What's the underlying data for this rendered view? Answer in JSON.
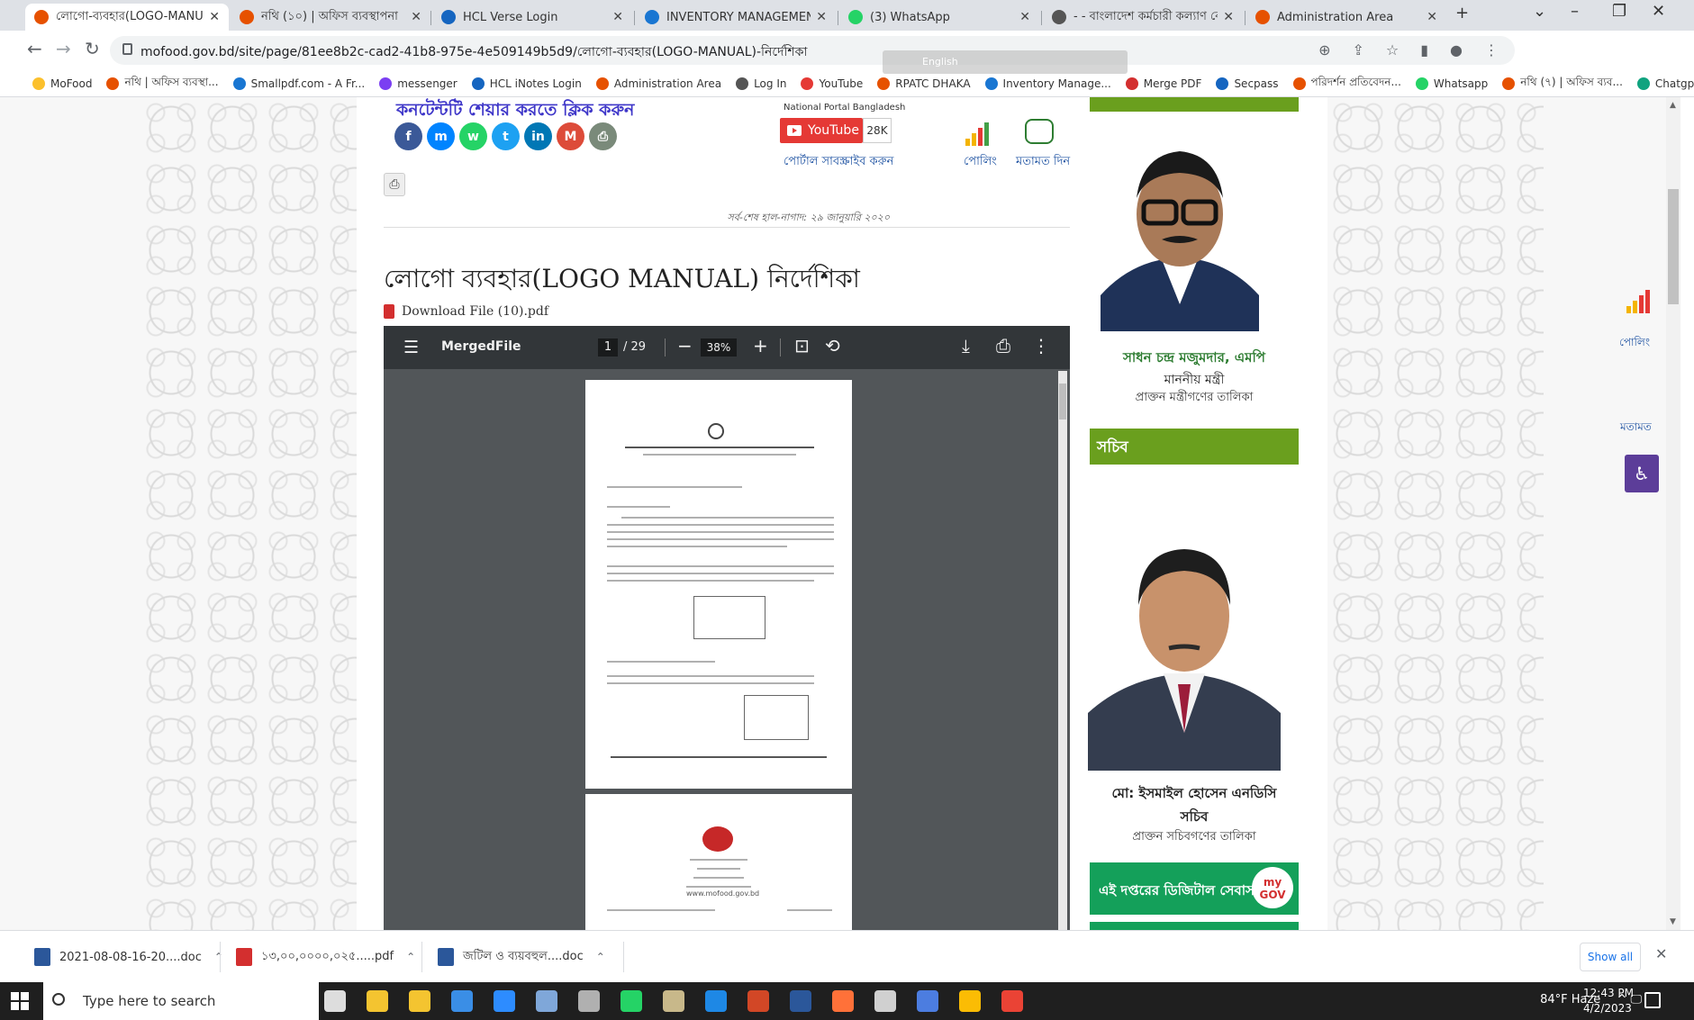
{
  "browser": {
    "tabs": [
      {
        "title": "লোগো-ব্যবহার(LOGO-MANUAL)",
        "color": "#e65100",
        "active": true
      },
      {
        "title": "নথি (১০) | অফিস ব্যবস্থাপনা",
        "color": "#e65100"
      },
      {
        "title": "HCL Verse Login",
        "color": "#1565c0"
      },
      {
        "title": "INVENTORY MANAGEMENT SYS",
        "color": "#1976d2"
      },
      {
        "title": "(3) WhatsApp",
        "color": "#25d366"
      },
      {
        "title": "- - বাংলাদেশ কর্মচারী কল্যাণ বো",
        "color": "#555555"
      },
      {
        "title": "Administration Area",
        "color": "#e65100"
      }
    ],
    "new_tab": "+",
    "window_controls": {
      "dropdown": "⌄",
      "minimize": "–",
      "restore": "❐",
      "close": "✕"
    },
    "nav": {
      "back": "←",
      "forward": "→",
      "reload": "↻"
    },
    "url": "mofood.gov.bd/site/page/81ee8b2c-cad2-41b8-975e-4e509149b5d9/লোগো-ব্যবহার(LOGO-MANUAL)-নির্দেশিকা",
    "omni_icons": {
      "zoom": "⊕",
      "share": "⇪",
      "star": "☆",
      "sidepanel": "▮",
      "profile": "●",
      "menu": "⋮"
    },
    "lang_strip": "English",
    "bookmarks": [
      {
        "label": "MoFood",
        "color": "#fbc02d"
      },
      {
        "label": "নথি | অফিস ব্যবস্থা...",
        "color": "#e65100"
      },
      {
        "label": "Smallpdf.com - A Fr...",
        "color": "#1976d2"
      },
      {
        "label": "messenger",
        "color": "#7b3ff2"
      },
      {
        "label": "HCL iNotes Login",
        "color": "#1565c0"
      },
      {
        "label": "Administration Area",
        "color": "#e65100"
      },
      {
        "label": "Log In",
        "color": "#555555"
      },
      {
        "label": "YouTube",
        "color": "#e53935"
      },
      {
        "label": "RPATC DHAKA",
        "color": "#e65100"
      },
      {
        "label": "Inventory Manage...",
        "color": "#1976d2"
      },
      {
        "label": "Merge PDF",
        "color": "#d32f2f"
      },
      {
        "label": "Secpass",
        "color": "#1565c0"
      },
      {
        "label": "পরিদর্শন প্রতিবেদন...",
        "color": "#e65100"
      },
      {
        "label": "Whatsapp",
        "color": "#25d366"
      },
      {
        "label": "নথি (৭) | অফিস ব্যব...",
        "color": "#e65100"
      },
      {
        "label": "Chatgpt",
        "color": "#10a37f"
      }
    ]
  },
  "page": {
    "share_title": "কনটেন্টটি শেয়ার করতে ক্লিক করুন",
    "share_buttons": [
      {
        "glyph": "f",
        "color": "#3b5998"
      },
      {
        "glyph": "m",
        "color": "#0084ff"
      },
      {
        "glyph": "w",
        "color": "#25d366"
      },
      {
        "glyph": "t",
        "color": "#1da1f2"
      },
      {
        "glyph": "in",
        "color": "#0077b5"
      },
      {
        "glyph": "M",
        "color": "#dd4b39"
      },
      {
        "glyph": "⎙",
        "color": "#7a8a7a"
      }
    ],
    "portal_label": "National Portal Bangladesh",
    "youtube_label": "YouTube",
    "youtube_count": "28K",
    "portal_subscribe": "পোর্টাল সাবস্ক্রাইব করুন",
    "poll_label": "পোলিং",
    "feedback_label": "মতামত দিন",
    "print_icon": "⎙",
    "last_updated": "সর্ব-শেষ হাল-নাগাদ: ২৯ জানুয়ারি ২০২০",
    "title": "লোগো ব্যবহার(LOGO MANUAL) নির্দেশিকা",
    "download_link": "Download File (10).pdf"
  },
  "pdf": {
    "menu_icon": "☰",
    "filename": "MergedFile",
    "current_page": "1",
    "total_pages": "/ 29",
    "zoom_out": "−",
    "zoom": "38%",
    "zoom_in": "+",
    "fit_icon": "⊡",
    "rotate_icon": "⟲",
    "download_icon": "⤓",
    "print_icon": "⎙",
    "more_icon": "⋮",
    "page2_url": "www.mofood.gov.bd"
  },
  "sidebar": {
    "minister_name": "সাধন চন্দ্র মজুমদার, এমপি",
    "minister_role": "মাননীয় মন্ত্রী",
    "minister_list": "প্রাক্তন মন্ত্রীগণের তালিকা",
    "secretary_header": "সচিব",
    "secretary_name": "মো: ইসমাইল হোসেন এনডিসি",
    "secretary_role": "সচিব",
    "secretary_list": "প্রাক্তন সচিবগণের তালিকা",
    "digital_services": "এই দপ্তরের ডিজিটাল সেবাসমূহ",
    "mygov_logo": "my GOV",
    "float_poll": "পোলিং",
    "float_feedback": "মতামত",
    "accessibility_icon": "♿"
  },
  "downloads": {
    "items": [
      {
        "label": "2021-08-08-16-20....doc",
        "color": "#2b579a"
      },
      {
        "label": "১৩,০০,০০০০,০২৫.....pdf",
        "color": "#d32f2f"
      },
      {
        "label": "জটিল ও ব্যয়বহুল....doc",
        "color": "#2b579a"
      }
    ],
    "chevron": "⌃",
    "show_all": "Show all",
    "close": "✕"
  },
  "taskbar": {
    "search_placeholder": "Type here to search",
    "apps": [
      {
        "name": "task-view",
        "color": "#dddddd"
      },
      {
        "name": "file-explorer",
        "color": "#f4c430"
      },
      {
        "name": "store",
        "color": "#f4c430"
      },
      {
        "name": "mail",
        "color": "#3a8ee6"
      },
      {
        "name": "zoom",
        "color": "#2d8cff"
      },
      {
        "name": "app-blue",
        "color": "#7fa7d9"
      },
      {
        "name": "app-rocket",
        "color": "#b0b0b0"
      },
      {
        "name": "whatsapp",
        "color": "#25d366"
      },
      {
        "name": "app-calc",
        "color": "#c8b88a"
      },
      {
        "name": "edge",
        "color": "#1e88e5"
      },
      {
        "name": "powerpoint",
        "color": "#d24726"
      },
      {
        "name": "word",
        "color": "#2b579a"
      },
      {
        "name": "firefox",
        "color": "#ff7139"
      },
      {
        "name": "calculator",
        "color": "#d0d0d0"
      },
      {
        "name": "app-arrow",
        "color": "#4c7de0"
      },
      {
        "name": "chrome",
        "color": "#fbbc04"
      },
      {
        "name": "chrome-2",
        "color": "#ea4335"
      }
    ],
    "weather": "84°F Haze",
    "tray_icons": "^ 🖵",
    "time": "12:43 PM",
    "date": "4/2/2023"
  }
}
